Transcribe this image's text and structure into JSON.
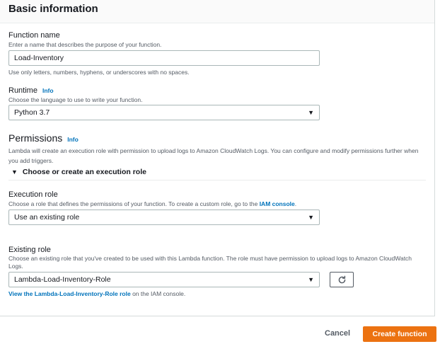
{
  "basic_info": {
    "title": "Basic information"
  },
  "function_name": {
    "label": "Function name",
    "description": "Enter a name that describes the purpose of your function.",
    "value": "Load-Inventory",
    "hint": "Use only letters, numbers, hyphens, or underscores with no spaces."
  },
  "runtime": {
    "label": "Runtime",
    "info": "Info",
    "description": "Choose the language to use to write your function.",
    "value": "Python 3.7"
  },
  "permissions": {
    "title": "Permissions",
    "info": "Info",
    "description": "Lambda will create an execution role with permission to upload logs to Amazon CloudWatch Logs. You can configure and modify permissions further when you add triggers.",
    "toggle_label": "Choose or create an execution role"
  },
  "execution_role": {
    "label": "Execution role",
    "description_prefix": "Choose a role that defines the permissions of your function. To create a custom role, go to the ",
    "description_link": "IAM console",
    "description_suffix": ".",
    "value": "Use an existing role"
  },
  "existing_role": {
    "label": "Existing role",
    "description": "Choose an existing role that you've created to be used with this Lambda function. The role must have permission to upload logs to Amazon CloudWatch Logs.",
    "value": "Lambda-Load-Inventory-Role",
    "link_text": "View the Lambda-Load-Inventory-Role role",
    "link_suffix": " on the IAM console."
  },
  "footer": {
    "cancel_label": "Cancel",
    "create_label": "Create function"
  },
  "icons": {
    "caret": "▼",
    "refresh": "refresh-icon"
  },
  "colors": {
    "primary": "#ec7211",
    "link": "#0073bb"
  }
}
